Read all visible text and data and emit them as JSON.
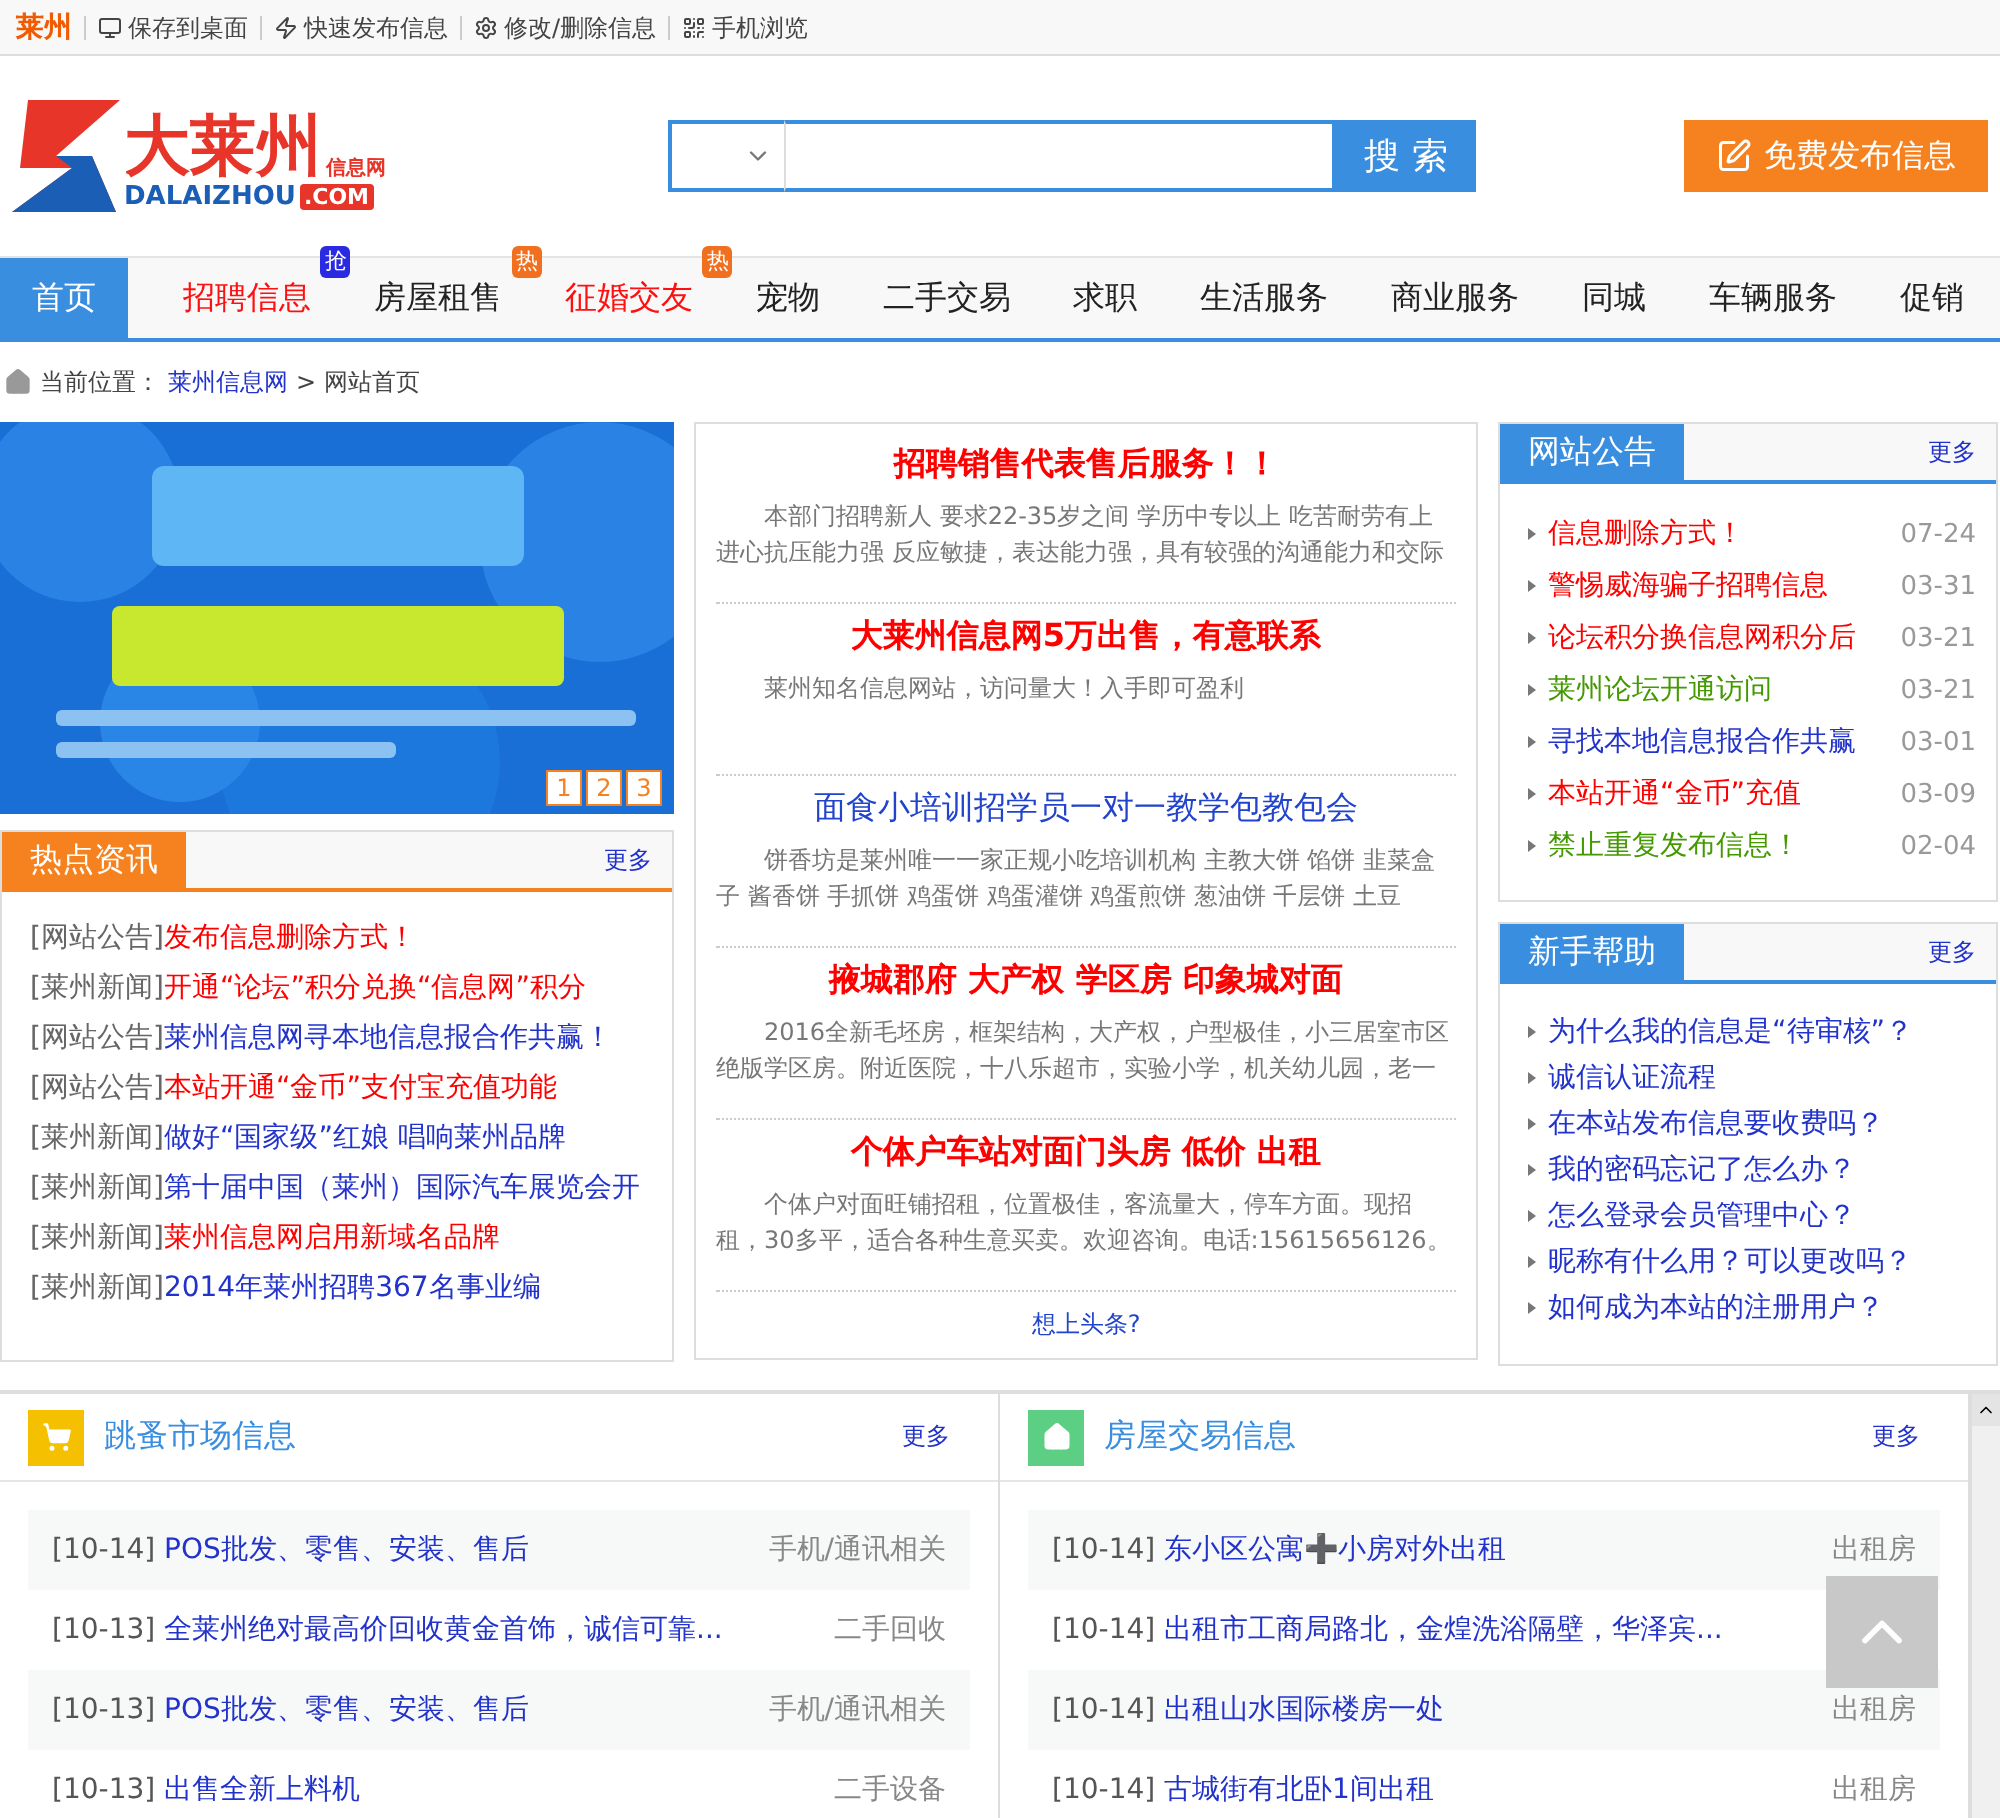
{
  "top_bar": {
    "city": "莱州",
    "links": [
      "保存到桌面",
      "快速发布信息",
      "修改/删除信息",
      "手机浏览"
    ]
  },
  "logo": {
    "name": "大莱州",
    "tag": "信息网",
    "domain": "DALAIZHOU",
    "tld": ".COM"
  },
  "search": {
    "button": "搜 索"
  },
  "publish_button": "免费发布信息",
  "nav": [
    {
      "label": "首页",
      "selected": true,
      "hot": false
    },
    {
      "label": "招聘信息",
      "selected": false,
      "hot": true,
      "badge": {
        "text": "抢",
        "color": "#2a2ae0"
      }
    },
    {
      "label": "房屋租售",
      "selected": false,
      "hot": false,
      "badge": {
        "text": "热",
        "color": "#f07020"
      }
    },
    {
      "label": "征婚交友",
      "selected": false,
      "hot": true,
      "badge": {
        "text": "热",
        "color": "#f07020"
      }
    },
    {
      "label": "宠物",
      "selected": false,
      "hot": false
    },
    {
      "label": "二手交易",
      "selected": false,
      "hot": false
    },
    {
      "label": "求职",
      "selected": false,
      "hot": false
    },
    {
      "label": "生活服务",
      "selected": false,
      "hot": false
    },
    {
      "label": "商业服务",
      "selected": false,
      "hot": false
    },
    {
      "label": "同城",
      "selected": false,
      "hot": false
    },
    {
      "label": "车辆服务",
      "selected": false,
      "hot": false
    },
    {
      "label": "促销",
      "selected": false,
      "hot": false
    }
  ],
  "breadcrumb": {
    "label": "当前位置：",
    "link": "莱州信息网",
    "current": "> 网站首页"
  },
  "banner": {
    "kind": "picture",
    "pages": [
      "1",
      "2",
      "3"
    ]
  },
  "hot_news": {
    "title": "热点资讯",
    "more": "更多",
    "items": [
      {
        "tag": "[网站公告]",
        "text": "发布信息删除方式！",
        "color": "#ff0000"
      },
      {
        "tag": "[莱州新闻]",
        "text": "开通“论坛”积分兑换“信息网”积分",
        "color": "#ff0000"
      },
      {
        "tag": "[网站公告]",
        "text": "莱州信息网寻本地信息报合作共赢！",
        "color": "#2233cc"
      },
      {
        "tag": "[网站公告]",
        "text": "本站开通“金币”支付宝充值功能",
        "color": "#ff0000"
      },
      {
        "tag": "[莱州新闻]",
        "text": "做好“国家级”红娘 唱响莱州品牌",
        "color": "#2233cc"
      },
      {
        "tag": "[莱州新闻]",
        "text": "第十届中国（莱州）国际汽车展览会开",
        "color": "#2233cc"
      },
      {
        "tag": "[莱州新闻]",
        "text": "莱州信息网启用新域名品牌",
        "color": "#ff0000"
      },
      {
        "tag": "[莱州新闻]",
        "text": "2014年莱州招聘367名事业编",
        "color": "#2233cc"
      }
    ]
  },
  "headlines": {
    "items": [
      {
        "title": "招聘销售代表售后服务！！",
        "color": "#ff0000",
        "bold": true,
        "desc": "本部门招聘新人 要求22-35岁之间 学历中专以上 吃苦耐劳有上进心抗压能力强 反应敏捷，表达能力强，具有较强的沟通能力和交际"
      },
      {
        "title": "大莱州信息网5万出售，有意联系",
        "color": "#ff0000",
        "bold": true,
        "desc": "莱州知名信息网站，访问量大！入手即可盈利"
      },
      {
        "title": "面食小培训招学员一对一教学包教包会",
        "color": "#2244cc",
        "bold": false,
        "desc": "饼香坊是莱州唯一一家正规小吃培训机构 主教大饼 馅饼 韭菜盒子 酱香饼 手抓饼 鸡蛋饼 鸡蛋灌饼 鸡蛋煎饼 葱油饼 千层饼 土豆"
      },
      {
        "title": "掖城郡府 大产权 学区房 印象城对面",
        "color": "#ff0000",
        "bold": true,
        "desc": "2016全新毛坯房，框架结构，大产权，户型极佳，小三居室市区绝版学区房。附近医院，十八乐超市，实验小学，机关幼儿园，老一"
      },
      {
        "title": "个体户车站对面门头房 低价 出租",
        "color": "#ff0000",
        "bold": true,
        "desc": "个体户对面旺铺招租，位置极佳，客流量大，停车方面。现招租，30多平，适合各种生意买卖。欢迎咨询。电话:15615656126。"
      }
    ],
    "more_link": "想上头条?"
  },
  "notices": {
    "title": "网站公告",
    "more": "更多",
    "items": [
      {
        "text": "信息删除方式！",
        "date": "07-24",
        "color": "#ff0000"
      },
      {
        "text": "警惕威海骗子招聘信息",
        "date": "03-31",
        "color": "#ff0000"
      },
      {
        "text": "论坛积分换信息网积分后",
        "date": "03-21",
        "color": "#ff0000"
      },
      {
        "text": "莱州论坛开通访问",
        "date": "03-21",
        "color": "#449900"
      },
      {
        "text": "寻找本地信息报合作共赢",
        "date": "03-01",
        "color": "#2233cc"
      },
      {
        "text": "本站开通“金币”充值",
        "date": "03-09",
        "color": "#ff0000"
      },
      {
        "text": "禁止重复发布信息！",
        "date": "02-04",
        "color": "#449900"
      }
    ]
  },
  "help": {
    "title": "新手帮助",
    "more": "更多",
    "items": [
      "为什么我的信息是“待审核”？",
      "诚信认证流程",
      "在本站发布信息要收费吗？",
      "我的密码忘记了怎么办？",
      "怎么登录会员管理中心？",
      "昵称有什么用？可以更改吗？",
      "如何成为本站的注册用户？"
    ]
  },
  "markets": [
    {
      "kind": "cart",
      "title": "跳蚤市场信息",
      "more": "更多",
      "rows": [
        {
          "date": "[10-14]",
          "title": "POS批发、零售、安装、售后",
          "category": "手机/通讯相关"
        },
        {
          "date": "[10-13]",
          "title": "全莱州绝对最高价回收黄金首饰，诚信可靠...",
          "category": "二手回收"
        },
        {
          "date": "[10-13]",
          "title": "POS批发、零售、安装、售后",
          "category": "手机/通讯相关"
        },
        {
          "date": "[10-13]",
          "title": "出售全新上料机",
          "category": "二手设备"
        }
      ]
    },
    {
      "kind": "home",
      "title": "房屋交易信息",
      "more": "更多",
      "rows": [
        {
          "date": "[10-14]",
          "title": "东小区公寓➕小房对外出租",
          "category": "出租房"
        },
        {
          "date": "[10-14]",
          "title": "出租市工商局路北，金煌洗浴隔壁，华泽宾..."
        },
        {
          "date": "[10-14]",
          "title": "出租山水国际楼房一处",
          "category": "出租房"
        },
        {
          "date": "[10-14]",
          "title": "古城街有北卧1间出租",
          "category": "出租房"
        }
      ]
    }
  ]
}
